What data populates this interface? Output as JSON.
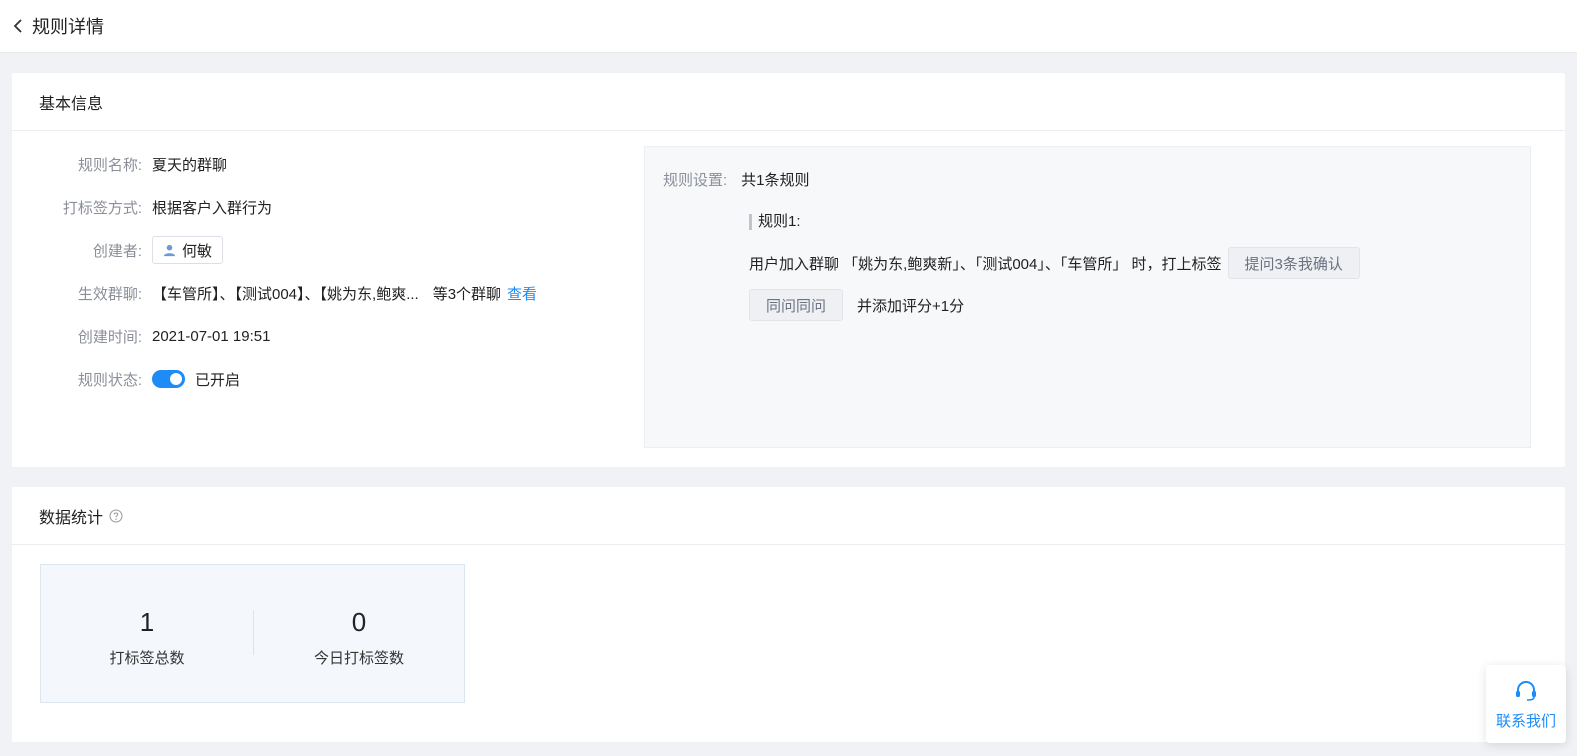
{
  "header": {
    "title": "规则详情"
  },
  "basic": {
    "title": "基本信息",
    "fields": {
      "name": {
        "label": "规则名称:",
        "value": "夏天的群聊"
      },
      "method": {
        "label": "打标签方式:",
        "value": "根据客户入群行为"
      },
      "creator": {
        "label": "创建者:",
        "value": "何敏"
      },
      "groups": {
        "label": "生效群聊:",
        "value": "【车管所】、【测试004】、【姚为东,鲍爽...",
        "count_text": "等3个群聊",
        "link": "查看"
      },
      "created": {
        "label": "创建时间:",
        "value": "2021-07-01 19:51"
      },
      "status": {
        "label": "规则状态:",
        "value": "已开启"
      }
    }
  },
  "rules": {
    "label": "规则设置:",
    "total": "共1条规则",
    "rule1_title": "规则1:",
    "rule1_text": "用户加入群聊 「姚为东,鲍爽新」、「测试004」、「车管所」 时，打上标签",
    "tag1": "提问3条我确认",
    "tag2": "同问同问",
    "score_text": "并添加评分+1分"
  },
  "stats": {
    "title": "数据统计",
    "items": [
      {
        "value": "1",
        "label": "打标签总数"
      },
      {
        "value": "0",
        "label": "今日打标签数"
      }
    ]
  },
  "contact": {
    "label": "联系我们"
  },
  "colors": {
    "accent": "#1d8cf8",
    "background": "#f0f2f5"
  },
  "icons": {
    "back": "chevron-left-icon",
    "user": "user-icon",
    "help": "question-circle-icon",
    "contact": "headset-icon"
  }
}
